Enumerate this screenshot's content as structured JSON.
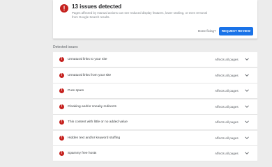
{
  "summary": {
    "icon": "error-icon",
    "title": "13 issues detected",
    "description": "Pages affected by manual actions can see reduced display features, lower ranking, or even removal from Google Search results.",
    "done_fixing": "Done fixing?",
    "request_review": "REQUEST REVIEW"
  },
  "section_label": "Detected issues",
  "issues": [
    {
      "title": "Unnatural links to your site",
      "scope": "Affects all pages"
    },
    {
      "title": "Unnatural links from your site",
      "scope": "Affects all pages"
    },
    {
      "title": "Pure spam",
      "scope": "Affects all pages"
    },
    {
      "title": "Cloaking and/or sneaky redirects",
      "scope": "Affects all pages"
    },
    {
      "title": "Thin content with little or no added value",
      "scope": "Affects all pages"
    },
    {
      "title": "Hidden text and/or keyword stuffing",
      "scope": "Affects all pages"
    },
    {
      "title": "Spammy free hosts",
      "scope": "Affects all pages"
    }
  ],
  "colors": {
    "error": "#c5221f",
    "primary_button": "#1a73e8",
    "background": "#ececec"
  }
}
